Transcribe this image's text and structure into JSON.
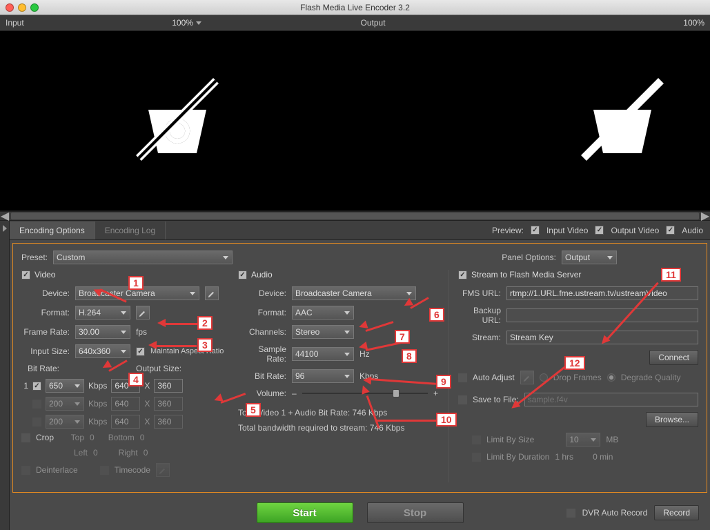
{
  "window": {
    "title": "Flash Media Live Encoder 3.2"
  },
  "preview": {
    "input_label": "Input",
    "input_zoom": "100%",
    "output_label": "Output",
    "output_zoom": "100%",
    "label": "Preview:",
    "opt_input": "Input Video",
    "opt_output": "Output Video",
    "opt_audio": "Audio"
  },
  "tabs": {
    "encoding_options": "Encoding Options",
    "encoding_log": "Encoding Log"
  },
  "preset": {
    "label": "Preset:",
    "value": "Custom"
  },
  "panel_options": {
    "label": "Panel Options:",
    "value": "Output"
  },
  "video": {
    "heading": "Video",
    "device_label": "Device:",
    "device": "Broadcaster Camera",
    "format_label": "Format:",
    "format": "H.264",
    "framerate_label": "Frame Rate:",
    "framerate": "30.00",
    "fps": "fps",
    "inputsize_label": "Input Size:",
    "inputsize": "640x360",
    "maintain_ar": "Maintain Aspect Ratio",
    "bitrate_label": "Bit Rate:",
    "outputsize_label": "Output Size:",
    "bitrows": [
      {
        "idx": "1",
        "enabled": true,
        "rate": "650",
        "w": "640",
        "h": "360"
      },
      {
        "idx": "",
        "enabled": false,
        "rate": "200",
        "w": "640",
        "h": "360"
      },
      {
        "idx": "",
        "enabled": false,
        "rate": "200",
        "w": "640",
        "h": "360"
      }
    ],
    "kbps": "Kbps",
    "x": "X",
    "crop": "Crop",
    "top": "Top",
    "top_v": "0",
    "bottom": "Bottom",
    "bottom_v": "0",
    "left": "Left",
    "left_v": "0",
    "right": "Right",
    "right_v": "0",
    "deinterlace": "Deinterlace",
    "timecode": "Timecode"
  },
  "audio": {
    "heading": "Audio",
    "device_label": "Device:",
    "device": "Broadcaster Camera",
    "format_label": "Format:",
    "format": "AAC",
    "channels_label": "Channels:",
    "channels": "Stereo",
    "samplerate_label": "Sample Rate:",
    "samplerate": "44100",
    "hz": "Hz",
    "bitrate_label": "Bit Rate:",
    "bitrate": "96",
    "kbps": "Kbps",
    "volume_label": "Volume:",
    "minus": "–",
    "plus": "+",
    "total1": "Total Video 1 + Audio Bit Rate: 746 Kbps",
    "total2": "Total bandwidth required to stream: 746 Kbps"
  },
  "server": {
    "heading": "Stream to Flash Media Server",
    "fmsurl_label": "FMS URL:",
    "fmsurl": "rtmp://1.URL.fme.ustream.tv/ustreamVideo",
    "backup_label": "Backup URL:",
    "backup": "",
    "stream_label": "Stream:",
    "stream": "Stream Key",
    "connect": "Connect",
    "autoadjust": "Auto Adjust",
    "dropframes": "Drop Frames",
    "degrade": "Degrade Quality",
    "savefile": "Save to File:",
    "savefile_ph": "sample.f4v",
    "browse": "Browse...",
    "limitsize": "Limit By Size",
    "limitsize_v": "10",
    "mb": "MB",
    "limitdur": "Limit By Duration",
    "hrs": "1 hrs",
    "min": "0 min"
  },
  "bottom": {
    "start": "Start",
    "stop": "Stop",
    "dvr": "DVR Auto Record",
    "record": "Record"
  },
  "annotations": [
    "1",
    "2",
    "3",
    "4",
    "5",
    "6",
    "7",
    "8",
    "9",
    "10",
    "11",
    "12"
  ]
}
